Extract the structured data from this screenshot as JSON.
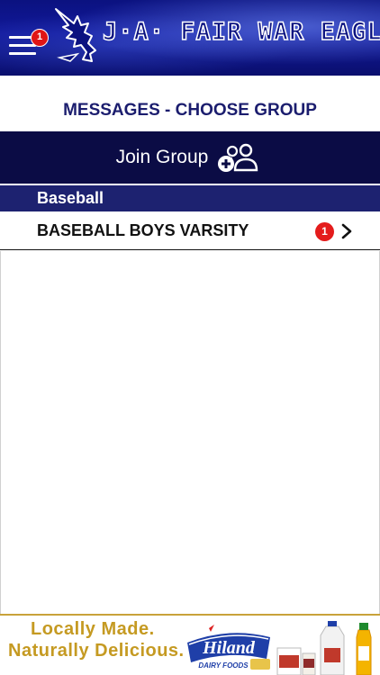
{
  "header": {
    "logo_text": "J·A· FAIR WAR EAGLES",
    "notification_count": "1",
    "colors": {
      "primary": "#11189a",
      "badge": "#e01515"
    }
  },
  "page": {
    "title": "MESSAGES - CHOOSE GROUP"
  },
  "join_group": {
    "label": "Join Group",
    "icon": "add-user-group-icon"
  },
  "sections": [
    {
      "label": "Baseball",
      "groups": [
        {
          "name": "BASEBALL BOYS VARSITY",
          "unread": "1",
          "icon": "chevron-right-icon"
        }
      ]
    }
  ],
  "ad": {
    "line1": "Locally Made.",
    "line2": "Naturally Delicious.",
    "brand": "Hiland",
    "brand_sub": "DAIRY FOODS"
  }
}
